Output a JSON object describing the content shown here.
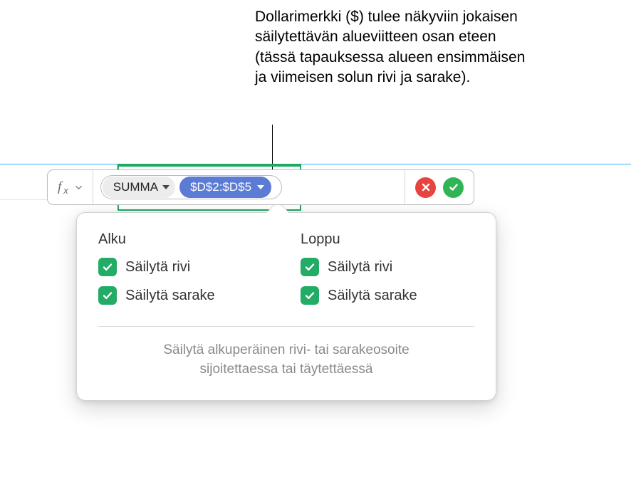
{
  "callout": "Dollarimerkki ($) tulee näkyviin jokaisen säilytettävän alueviitteen osan eteen (tässä tapauksessa alueen ensimmäisen ja viimeisen solun rivi ja sarake).",
  "formula_bar": {
    "fx": "f",
    "fx_sub": "x",
    "function_token": "SUMMA",
    "reference_token": "$D$2:$D$5"
  },
  "popover": {
    "start": {
      "heading": "Alku",
      "row": "Säilytä rivi",
      "col": "Säilytä sarake"
    },
    "end": {
      "heading": "Loppu",
      "row": "Säilytä rivi",
      "col": "Säilytä sarake"
    },
    "footer_line1": "Säilytä alkuperäinen rivi- tai sarakeosoite",
    "footer_line2": "sijoitettaessa tai täytettäessä"
  }
}
